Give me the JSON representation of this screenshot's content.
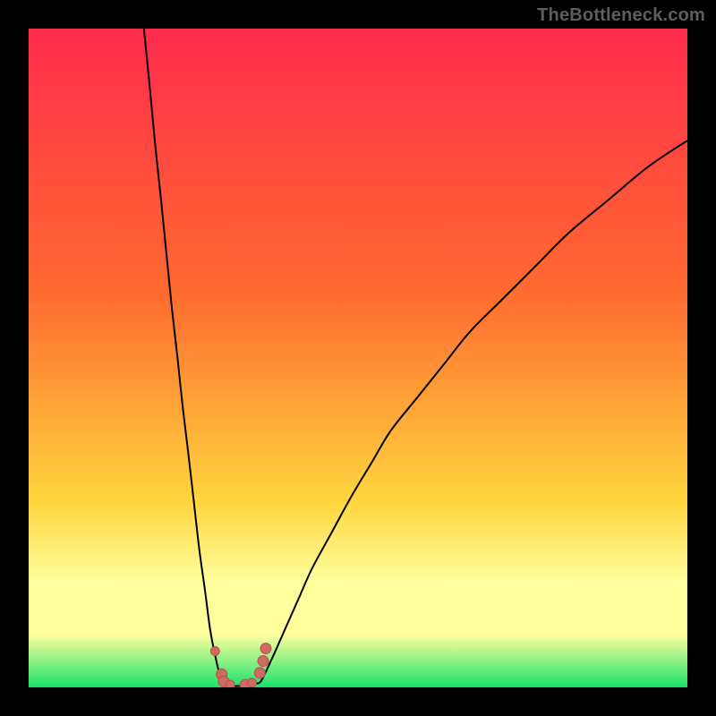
{
  "watermark": "TheBottleneck.com",
  "colors": {
    "frame": "#000000",
    "gradient_top": "#ff2b4d",
    "gradient_mid1": "#ff6a2f",
    "gradient_mid2": "#ffd63f",
    "gradient_band": "#ffff9e",
    "gradient_bottom": "#19e26a",
    "curve": "#000000",
    "marker_fill": "#cf6a62",
    "marker_stroke": "#b6524b"
  },
  "chart_data": {
    "type": "line",
    "title": "",
    "xlabel": "",
    "ylabel": "",
    "xlim": [
      0,
      100
    ],
    "ylim": [
      0,
      100
    ],
    "grid": false,
    "series": [
      {
        "name": "left-arm",
        "x": [
          17.5,
          18.4,
          19.2,
          20.1,
          20.9,
          21.7,
          22.6,
          23.4,
          24.3,
          25.1,
          25.9,
          26.8,
          27.6,
          28.5,
          29.3
        ],
        "y": [
          100,
          91,
          82.5,
          74,
          66,
          58,
          50,
          42.5,
          35,
          28,
          21,
          14.5,
          8.5,
          4,
          1
        ]
      },
      {
        "name": "valley",
        "x": [
          29.3,
          30,
          30.8,
          31.7,
          32.6,
          33.5,
          34.4,
          35.3
        ],
        "y": [
          1,
          0.4,
          0.2,
          0.2,
          0.2,
          0.3,
          0.6,
          1
        ]
      },
      {
        "name": "right-arm",
        "x": [
          35.3,
          37,
          39,
          41,
          43,
          46,
          49,
          52,
          55,
          59,
          63,
          67,
          72,
          77,
          82,
          88,
          94,
          100
        ],
        "y": [
          1,
          4.5,
          9,
          13.5,
          18,
          23.5,
          29,
          34,
          39,
          44,
          49,
          54,
          59,
          64,
          69,
          74,
          79,
          83
        ]
      }
    ],
    "markers": [
      {
        "x": 28.3,
        "y": 5.5,
        "r": 5
      },
      {
        "x": 29.3,
        "y": 2.0,
        "r": 6
      },
      {
        "x": 29.6,
        "y": 0.9,
        "r": 6
      },
      {
        "x": 30.6,
        "y": 0.4,
        "r": 5
      },
      {
        "x": 32.9,
        "y": 0.4,
        "r": 6
      },
      {
        "x": 33.9,
        "y": 0.7,
        "r": 5
      },
      {
        "x": 35.1,
        "y": 2.2,
        "r": 6
      },
      {
        "x": 35.6,
        "y": 4.0,
        "r": 6
      },
      {
        "x": 36.0,
        "y": 5.9,
        "r": 6
      }
    ],
    "gradient_stops": [
      {
        "offset": 0.0,
        "key": "gradient_top"
      },
      {
        "offset": 0.4,
        "key": "gradient_mid1"
      },
      {
        "offset": 0.72,
        "key": "gradient_mid2"
      },
      {
        "offset": 0.84,
        "key": "gradient_band"
      },
      {
        "offset": 0.92,
        "key": "gradient_band"
      },
      {
        "offset": 1.0,
        "key": "gradient_bottom"
      }
    ]
  }
}
